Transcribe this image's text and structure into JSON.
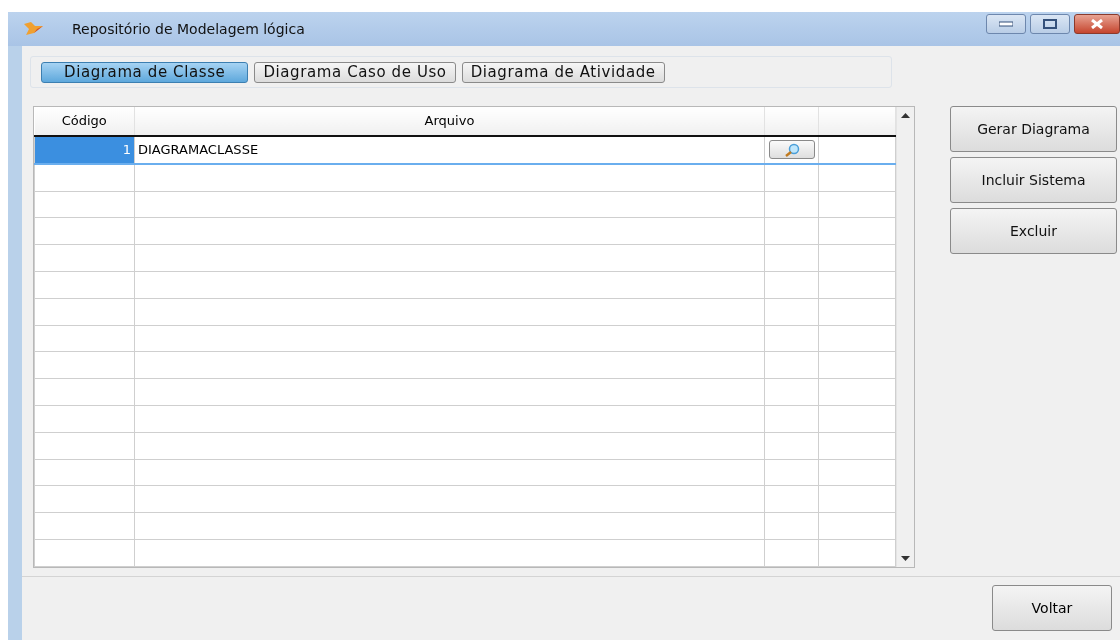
{
  "window": {
    "title": "Repositório de Modelagem lógica"
  },
  "tabs": [
    {
      "label": "Diagrama de Classe",
      "selected": true
    },
    {
      "label": "Diagrama Caso de Uso",
      "selected": false
    },
    {
      "label": "Diagrama de Atividade",
      "selected": false
    }
  ],
  "table": {
    "columns": [
      "Código",
      "Arquivo"
    ],
    "rows": [
      {
        "codigo": "1",
        "arquivo": "DIAGRAMACLASSE",
        "selected": true
      }
    ]
  },
  "actions": [
    "Gerar Diagrama",
    "Incluir Sistema",
    "Excluir"
  ],
  "footer": {
    "button": "Voltar"
  }
}
